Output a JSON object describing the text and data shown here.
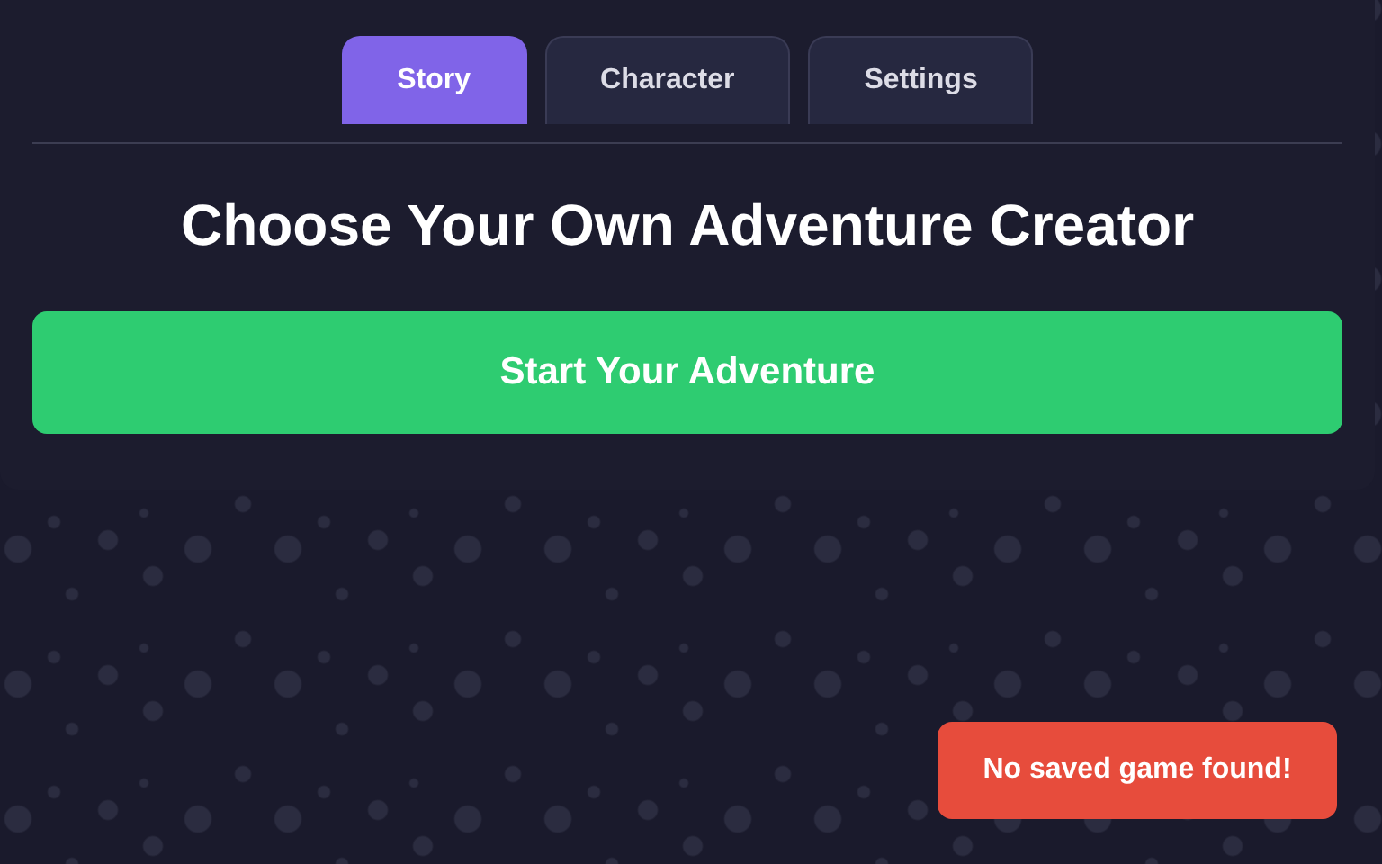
{
  "tabs": [
    {
      "label": "Story",
      "selected": true
    },
    {
      "label": "Character",
      "selected": false
    },
    {
      "label": "Settings",
      "selected": false
    }
  ],
  "title": "Choose Your Own Adventure Creator",
  "start_button": "Start Your Adventure",
  "toast": "No saved game found!"
}
